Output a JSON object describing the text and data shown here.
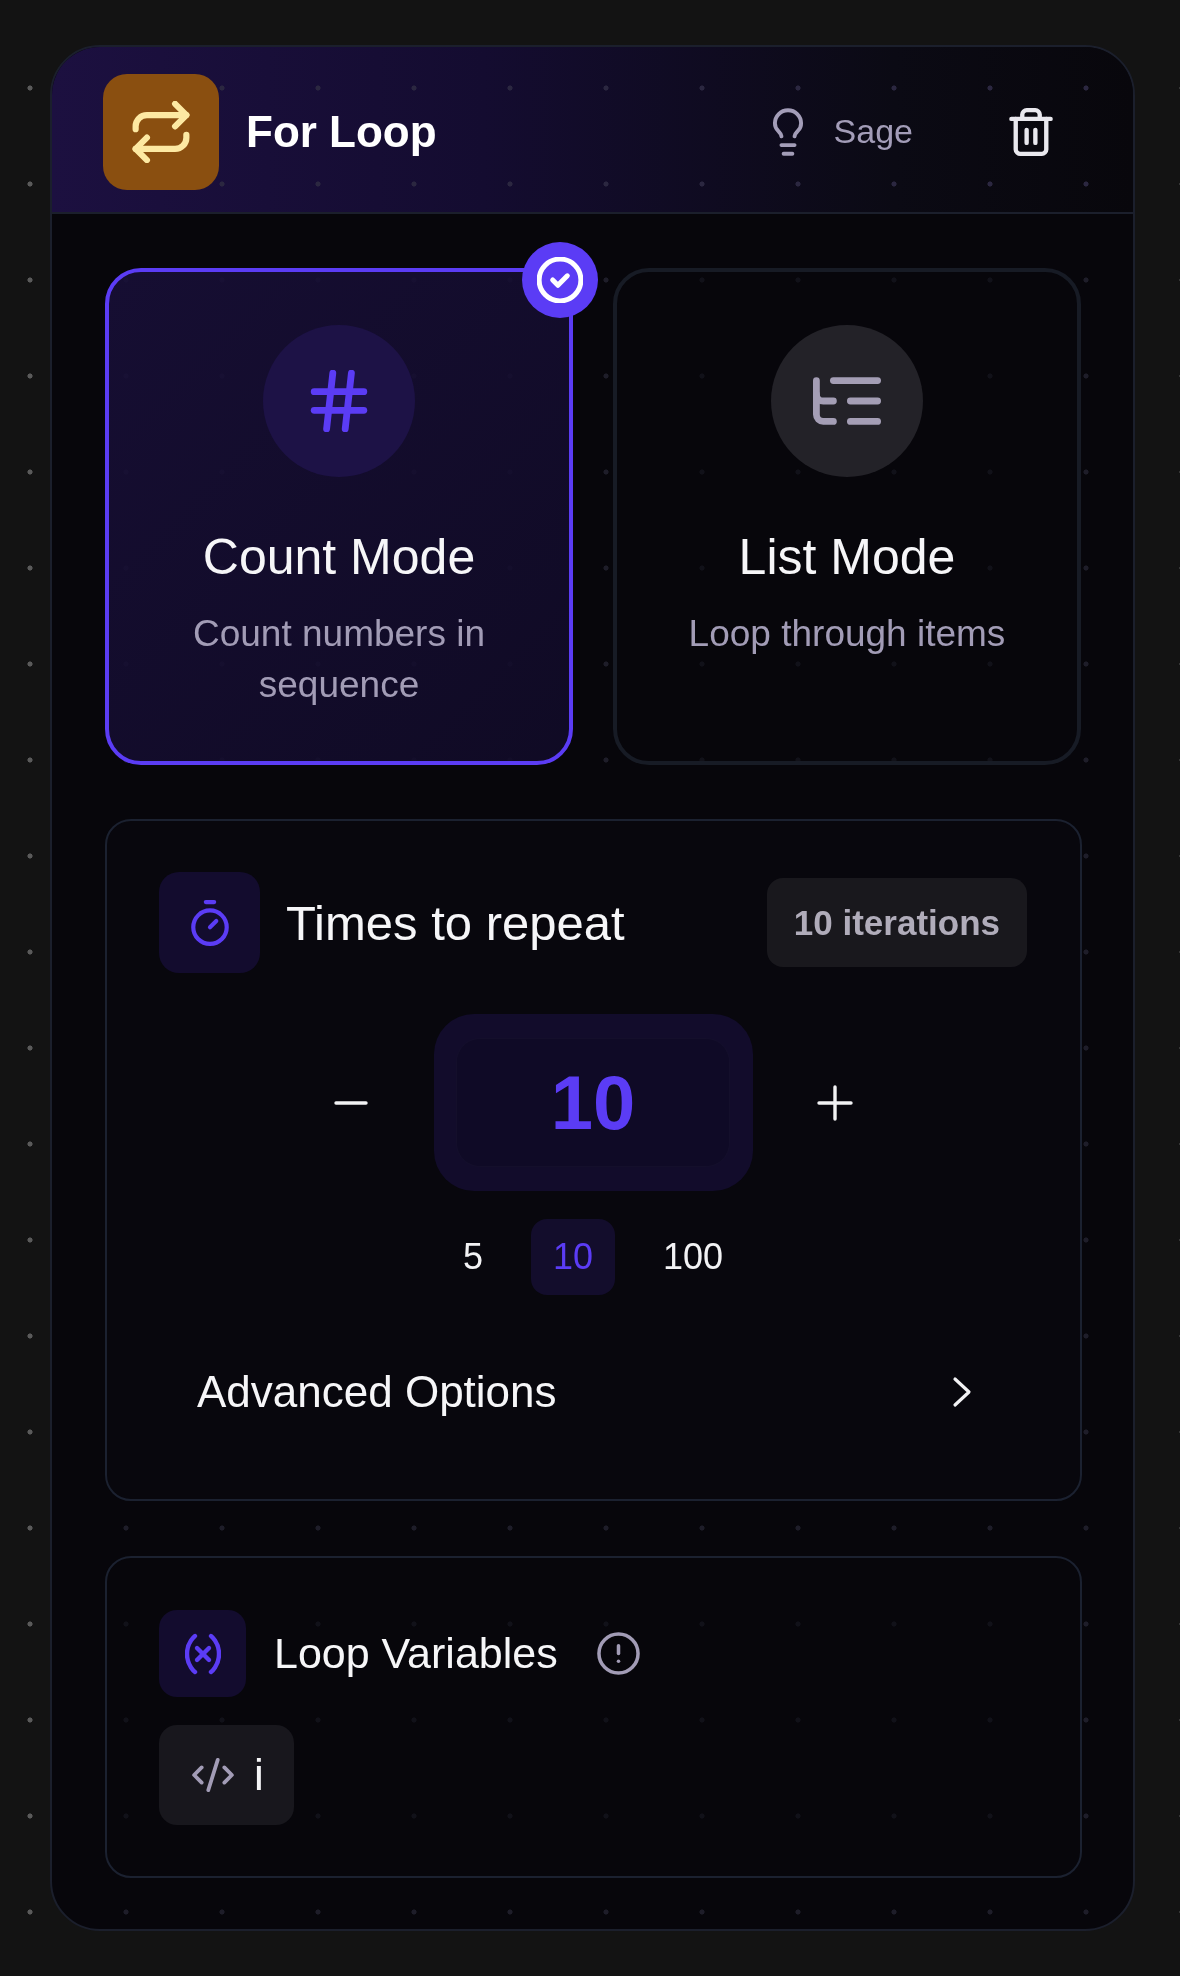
{
  "node": {
    "title": "For Loop",
    "assistant": {
      "label": "Sage"
    }
  },
  "modes": [
    {
      "kind": "count",
      "title": "Count Mode",
      "description": "Count numbers in sequence",
      "selected": true
    },
    {
      "kind": "list",
      "title": "List Mode",
      "description": "Loop through items",
      "selected": false
    }
  ],
  "repeat": {
    "label": "Times to repeat",
    "badge": "10 iterations",
    "value": "10",
    "presets": [
      {
        "label": "5",
        "selected": false
      },
      {
        "label": "10",
        "selected": true
      },
      {
        "label": "100",
        "selected": false
      }
    ]
  },
  "advanced": {
    "label": "Advanced Options",
    "expanded": false
  },
  "variables": {
    "title": "Loop Variables",
    "items": [
      {
        "name": "i"
      }
    ]
  }
}
